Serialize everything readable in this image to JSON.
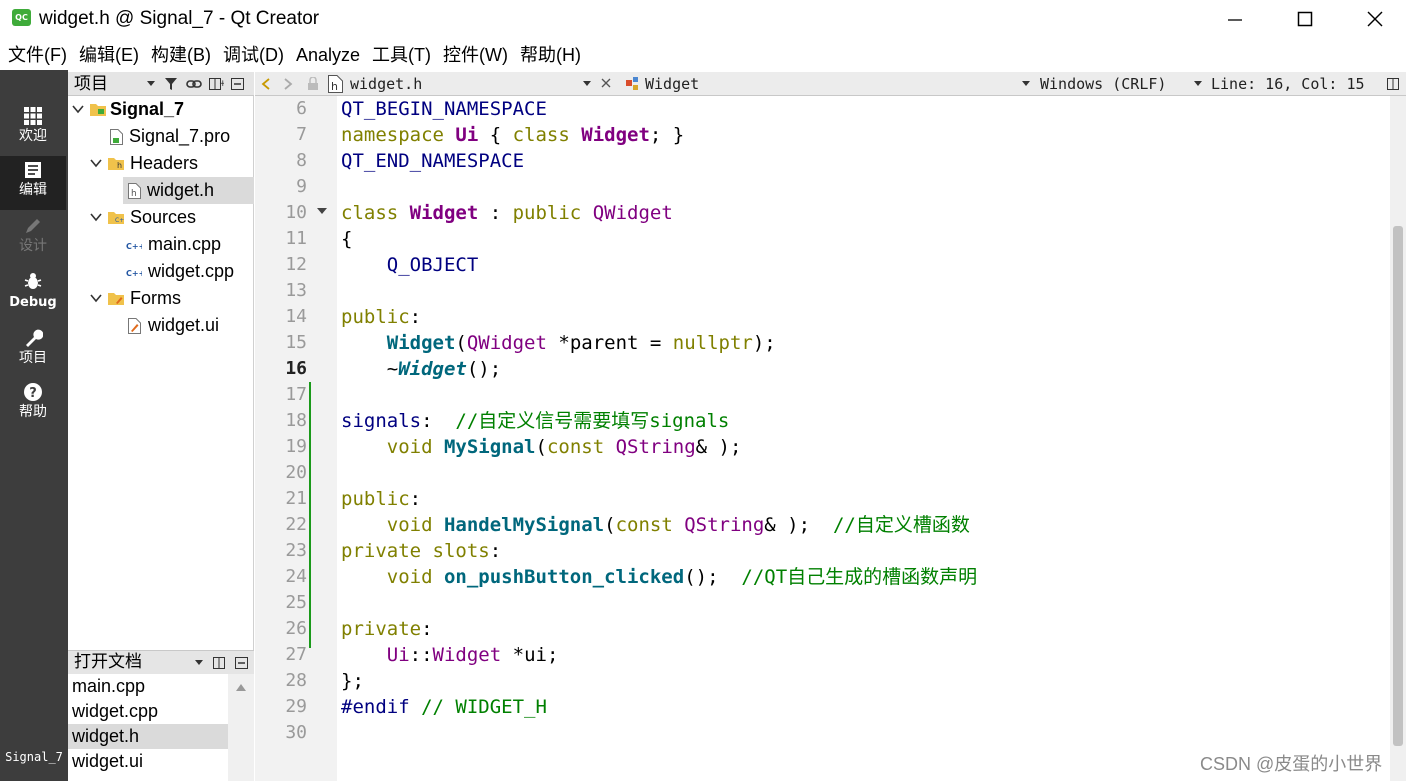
{
  "window": {
    "title": "widget.h @ Signal_7 - Qt Creator",
    "logo_text": "QC"
  },
  "menu": [
    "文件(F)",
    "编辑(E)",
    "构建(B)",
    "调试(D)",
    "Analyze",
    "工具(T)",
    "控件(W)",
    "帮助(H)"
  ],
  "modes": [
    {
      "label": "欢迎",
      "icon": "grid-icon"
    },
    {
      "label": "编辑",
      "icon": "edit-document-icon"
    },
    {
      "label": "设计",
      "icon": "pencil-icon"
    },
    {
      "label": "Debug",
      "icon": "bug-icon"
    },
    {
      "label": "项目",
      "icon": "wrench-icon"
    },
    {
      "label": "帮助",
      "icon": "help-icon"
    }
  ],
  "current_project": "Signal_7",
  "project_panel": {
    "title": "项目",
    "tree": [
      {
        "label": "Signal_7",
        "kind": "project"
      },
      {
        "label": "Signal_7.pro",
        "kind": "pro-file"
      },
      {
        "label": "Headers",
        "kind": "folder"
      },
      {
        "label": "widget.h",
        "kind": "header-file"
      },
      {
        "label": "Sources",
        "kind": "folder"
      },
      {
        "label": "main.cpp",
        "kind": "cpp-file"
      },
      {
        "label": "widget.cpp",
        "kind": "cpp-file"
      },
      {
        "label": "Forms",
        "kind": "folder"
      },
      {
        "label": "widget.ui",
        "kind": "ui-file"
      }
    ]
  },
  "open_documents": {
    "title": "打开文档",
    "items": [
      "main.cpp",
      "widget.cpp",
      "widget.h",
      "widget.ui"
    ],
    "selected": "widget.h"
  },
  "editor": {
    "file": "widget.h",
    "symbol": "Widget",
    "line_ending": "Windows (CRLF)",
    "cursor": "Line: 16, Col: 15",
    "line_numbers": [
      "6",
      "7",
      "8",
      "9",
      "10",
      "11",
      "12",
      "13",
      "14",
      "15",
      "16",
      "17",
      "18",
      "19",
      "20",
      "21",
      "22",
      "23",
      "24",
      "25",
      "26",
      "27",
      "28",
      "29",
      "30"
    ],
    "current_line": "16",
    "lines": [
      [
        {
          "t": "QT_BEGIN_NAMESPACE",
          "c": "mac"
        }
      ],
      [
        {
          "t": "namespace ",
          "c": "kw"
        },
        {
          "t": "Ui",
          "c": "cls bold"
        },
        {
          "t": " { ",
          "c": "pl"
        },
        {
          "t": "class ",
          "c": "kw"
        },
        {
          "t": "Widget",
          "c": "cls bold"
        },
        {
          "t": "; }",
          "c": "pl"
        }
      ],
      [
        {
          "t": "QT_END_NAMESPACE",
          "c": "mac"
        }
      ],
      [],
      [
        {
          "t": "class ",
          "c": "kw"
        },
        {
          "t": "Widget",
          "c": "cls bold"
        },
        {
          "t": " : ",
          "c": "pl"
        },
        {
          "t": "public ",
          "c": "kw"
        },
        {
          "t": "QWidget",
          "c": "cls"
        }
      ],
      [
        {
          "t": "{",
          "c": "pl"
        }
      ],
      [
        {
          "t": "    Q_OBJECT",
          "c": "mac"
        }
      ],
      [],
      [
        {
          "t": "public",
          "c": "kw"
        },
        {
          "t": ":",
          "c": "pl"
        }
      ],
      [
        {
          "t": "    ",
          "c": "pl"
        },
        {
          "t": "Widget",
          "c": "fn"
        },
        {
          "t": "(",
          "c": "pl"
        },
        {
          "t": "QWidget",
          "c": "cls"
        },
        {
          "t": " *parent = ",
          "c": "pl"
        },
        {
          "t": "nullptr",
          "c": "kw"
        },
        {
          "t": ");",
          "c": "pl"
        }
      ],
      [
        {
          "t": "    ~",
          "c": "pl"
        },
        {
          "t": "Widget",
          "c": "fni"
        },
        {
          "t": "();",
          "c": "pl"
        }
      ],
      [],
      [
        {
          "t": "signals",
          "c": "mac"
        },
        {
          "t": ":  ",
          "c": "pl"
        },
        {
          "t": "//自定义信号需要填写signals",
          "c": "cm"
        }
      ],
      [
        {
          "t": "    ",
          "c": "pl"
        },
        {
          "t": "void ",
          "c": "kw"
        },
        {
          "t": "MySignal",
          "c": "fn"
        },
        {
          "t": "(",
          "c": "pl"
        },
        {
          "t": "const ",
          "c": "kw"
        },
        {
          "t": "QString",
          "c": "cls"
        },
        {
          "t": "& );",
          "c": "pl"
        }
      ],
      [],
      [
        {
          "t": "public",
          "c": "kw"
        },
        {
          "t": ":",
          "c": "pl"
        }
      ],
      [
        {
          "t": "    ",
          "c": "pl"
        },
        {
          "t": "void ",
          "c": "kw"
        },
        {
          "t": "HandelMySignal",
          "c": "fn"
        },
        {
          "t": "(",
          "c": "pl"
        },
        {
          "t": "const ",
          "c": "kw"
        },
        {
          "t": "QString",
          "c": "cls"
        },
        {
          "t": "& );  ",
          "c": "pl"
        },
        {
          "t": "//自定义槽函数",
          "c": "cm"
        }
      ],
      [
        {
          "t": "private slots",
          "c": "kw"
        },
        {
          "t": ":",
          "c": "pl"
        }
      ],
      [
        {
          "t": "    ",
          "c": "pl"
        },
        {
          "t": "void ",
          "c": "kw"
        },
        {
          "t": "on_pushButton_clicked",
          "c": "fn"
        },
        {
          "t": "();  ",
          "c": "pl"
        },
        {
          "t": "//QT自己生成的槽函数声明",
          "c": "cm"
        }
      ],
      [],
      [
        {
          "t": "private",
          "c": "kw"
        },
        {
          "t": ":",
          "c": "pl"
        }
      ],
      [
        {
          "t": "    ",
          "c": "pl"
        },
        {
          "t": "Ui",
          "c": "cls"
        },
        {
          "t": "::",
          "c": "pl"
        },
        {
          "t": "Widget",
          "c": "cls"
        },
        {
          "t": " *ui;",
          "c": "pl"
        }
      ],
      [
        {
          "t": "};",
          "c": "pl"
        }
      ],
      [
        {
          "t": "#endif ",
          "c": "mac"
        },
        {
          "t": "// WIDGET_H",
          "c": "cm"
        }
      ],
      []
    ]
  },
  "watermark": "CSDN @皮蛋的小世界"
}
